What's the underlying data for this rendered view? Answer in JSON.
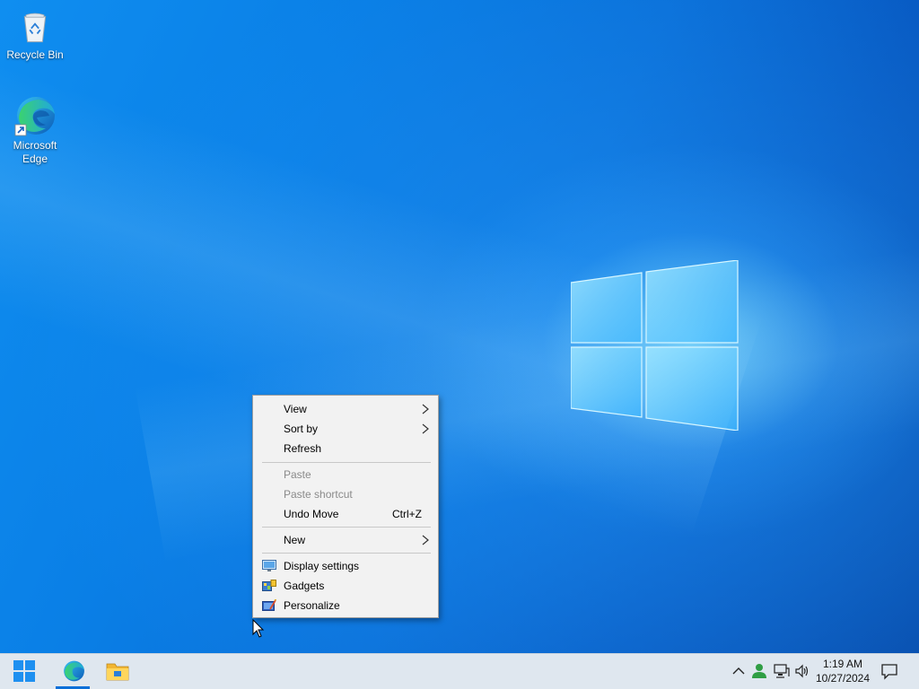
{
  "desktop": {
    "icons": [
      {
        "label": "Recycle Bin",
        "icon": "recycle-bin-icon"
      },
      {
        "label": "Microsoft Edge",
        "icon": "edge-icon"
      }
    ]
  },
  "context_menu": {
    "items": [
      {
        "label": "View",
        "submenu": true,
        "disabled": false
      },
      {
        "label": "Sort by",
        "submenu": true,
        "disabled": false
      },
      {
        "label": "Refresh",
        "submenu": false,
        "disabled": false
      },
      {
        "label": "Paste",
        "disabled": true
      },
      {
        "label": "Paste shortcut",
        "disabled": true
      },
      {
        "label": "Undo Move",
        "shortcut": "Ctrl+Z",
        "disabled": false
      },
      {
        "label": "New",
        "submenu": true,
        "disabled": false
      },
      {
        "label": "Display settings",
        "icon": "display-settings-icon",
        "disabled": false
      },
      {
        "label": "Gadgets",
        "icon": "gadgets-icon",
        "disabled": false
      },
      {
        "label": "Personalize",
        "icon": "personalize-icon",
        "disabled": false
      }
    ]
  },
  "taskbar": {
    "start": "windows-start-icon",
    "pinned": [
      "edge-icon",
      "file-explorer-icon"
    ],
    "tray": [
      "chevron-up-icon",
      "user-network-icon",
      "network-icon",
      "volume-icon"
    ],
    "time": "1:19 AM",
    "date": "10/27/2024",
    "accent": "#0a6fd8"
  }
}
